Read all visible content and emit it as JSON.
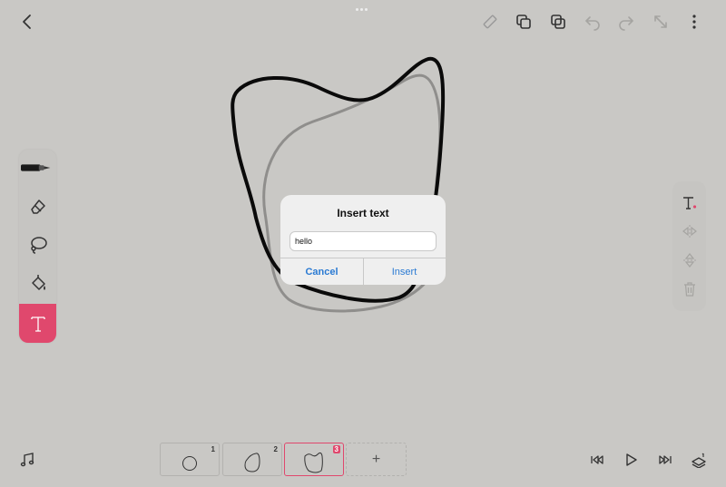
{
  "dialog": {
    "title": "Insert text",
    "input_value": "hello",
    "cancel_label": "Cancel",
    "insert_label": "Insert"
  },
  "frames": [
    {
      "number": "1",
      "active": false
    },
    {
      "number": "2",
      "active": false
    },
    {
      "number": "3",
      "active": true
    }
  ],
  "frame_add_label": "+",
  "colors": {
    "accent": "#e0486d",
    "background": "#c9c8c5",
    "dialog_button": "#2a7ad3"
  },
  "icons": {
    "topbar": [
      "back-chevron-icon",
      "ruler-icon",
      "copy-frame-icon",
      "duplicate-icon",
      "undo-icon",
      "redo-icon",
      "fullscreen-icon",
      "more-icon"
    ],
    "left_toolbar": [
      "pen-icon",
      "eraser-icon",
      "lasso-icon",
      "fill-bucket-icon",
      "text-tool-icon"
    ],
    "right_toolbar": [
      "text-color-icon",
      "flip-horizontal-icon",
      "flip-vertical-icon",
      "trash-icon"
    ],
    "bottombar": [
      "music-icon",
      "skip-back-icon",
      "play-icon",
      "skip-forward-icon",
      "layers-icon"
    ]
  }
}
